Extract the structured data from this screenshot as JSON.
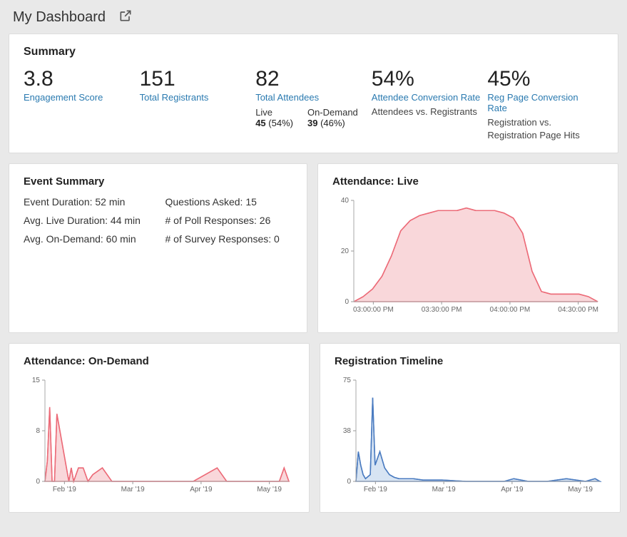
{
  "header": {
    "title": "My Dashboard"
  },
  "summary": {
    "title": "Summary",
    "kpis": {
      "engagement": {
        "value": "3.8",
        "label": "Engagement Score"
      },
      "registrants": {
        "value": "151",
        "label": "Total Registrants"
      },
      "attendees": {
        "value": "82",
        "label": "Total Attendees",
        "live": {
          "label": "Live",
          "count": "45",
          "pct": "(54%)"
        },
        "ondemand": {
          "label": "On-Demand",
          "count": "39",
          "pct": "(46%)"
        }
      },
      "attendee_conv": {
        "value": "54%",
        "label": "Attendee Conversion Rate",
        "sub": "Attendees vs. Registrants"
      },
      "regpage_conv": {
        "value": "45%",
        "label": "Reg Page Conversion Rate",
        "sub": "Registration vs. Registration Page Hits"
      }
    }
  },
  "event_summary": {
    "title": "Event Summary",
    "items": {
      "duration": "Event Duration: 52 min",
      "questions": "Questions Asked: 15",
      "avg_live": "Avg. Live Duration: 44 min",
      "polls": "# of Poll Responses: 26",
      "avg_od": "Avg. On-Demand: 60 min",
      "surveys": "# of Survey Responses: 0"
    }
  },
  "charts": {
    "live": {
      "title": "Attendance: Live"
    },
    "ondemand": {
      "title": "Attendance: On-Demand"
    },
    "registration": {
      "title": "Registration Timeline"
    }
  },
  "chart_data": [
    {
      "id": "live",
      "type": "area",
      "title": "Attendance: Live",
      "xlabel": "",
      "ylabel": "",
      "ylim": [
        0,
        40
      ],
      "x_ticks": [
        "03:00:00 PM",
        "03:30:00 PM",
        "04:00:00 PM",
        "04:30:00 PM"
      ],
      "x": [
        "02:47 PM",
        "02:50 PM",
        "02:53 PM",
        "02:55 PM",
        "02:57 PM",
        "03:00 PM",
        "03:03 PM",
        "03:06 PM",
        "03:09 PM",
        "03:12 PM",
        "03:15 PM",
        "03:20 PM",
        "03:25 PM",
        "03:30 PM",
        "03:35 PM",
        "03:40 PM",
        "03:45 PM",
        "03:48 PM",
        "03:50 PM",
        "03:52 PM",
        "03:55 PM",
        "04:00 PM",
        "04:05 PM",
        "04:10 PM",
        "04:15 PM",
        "04:30 PM",
        "04:38 PM"
      ],
      "values": [
        0,
        2,
        5,
        10,
        18,
        28,
        32,
        34,
        35,
        36,
        36,
        36,
        37,
        36,
        36,
        36,
        35,
        33,
        27,
        12,
        4,
        3,
        3,
        3,
        3,
        2,
        0
      ],
      "color": "#ec6b78"
    },
    {
      "id": "ondemand",
      "type": "area",
      "title": "Attendance: On-Demand",
      "xlabel": "",
      "ylabel": "",
      "ylim": [
        0,
        15
      ],
      "x_ticks": [
        "Feb '19",
        "Mar '19",
        "Apr '19",
        "May '19"
      ],
      "x": [
        0,
        1,
        2,
        3,
        4,
        5,
        6,
        8,
        10,
        11,
        12,
        14,
        16,
        18,
        20,
        24,
        28,
        30,
        36,
        46,
        62,
        72,
        76,
        80,
        88,
        98,
        100,
        102
      ],
      "values": [
        0,
        3,
        11,
        0,
        0,
        10,
        8,
        4,
        0,
        2,
        0,
        2,
        2,
        0,
        1,
        2,
        0,
        0,
        0,
        0,
        0,
        2,
        0,
        0,
        0,
        0,
        2,
        0
      ],
      "color": "#ec6b78"
    },
    {
      "id": "registration",
      "type": "area",
      "title": "Registration Timeline",
      "xlabel": "",
      "ylabel": "",
      "ylim": [
        0,
        75
      ],
      "x_ticks": [
        "Feb '19",
        "Mar '19",
        "Apr '19",
        "May '19"
      ],
      "x": [
        0,
        1,
        2,
        3,
        4,
        6,
        7,
        8,
        10,
        12,
        14,
        16,
        18,
        20,
        24,
        28,
        36,
        46,
        62,
        66,
        72,
        80,
        88,
        96,
        100,
        102
      ],
      "values": [
        0,
        22,
        12,
        5,
        2,
        5,
        62,
        12,
        22,
        10,
        5,
        3,
        2,
        2,
        2,
        1,
        1,
        0,
        0,
        2,
        0,
        0,
        2,
        0,
        2,
        0
      ],
      "color": "#4a7bc0"
    }
  ]
}
